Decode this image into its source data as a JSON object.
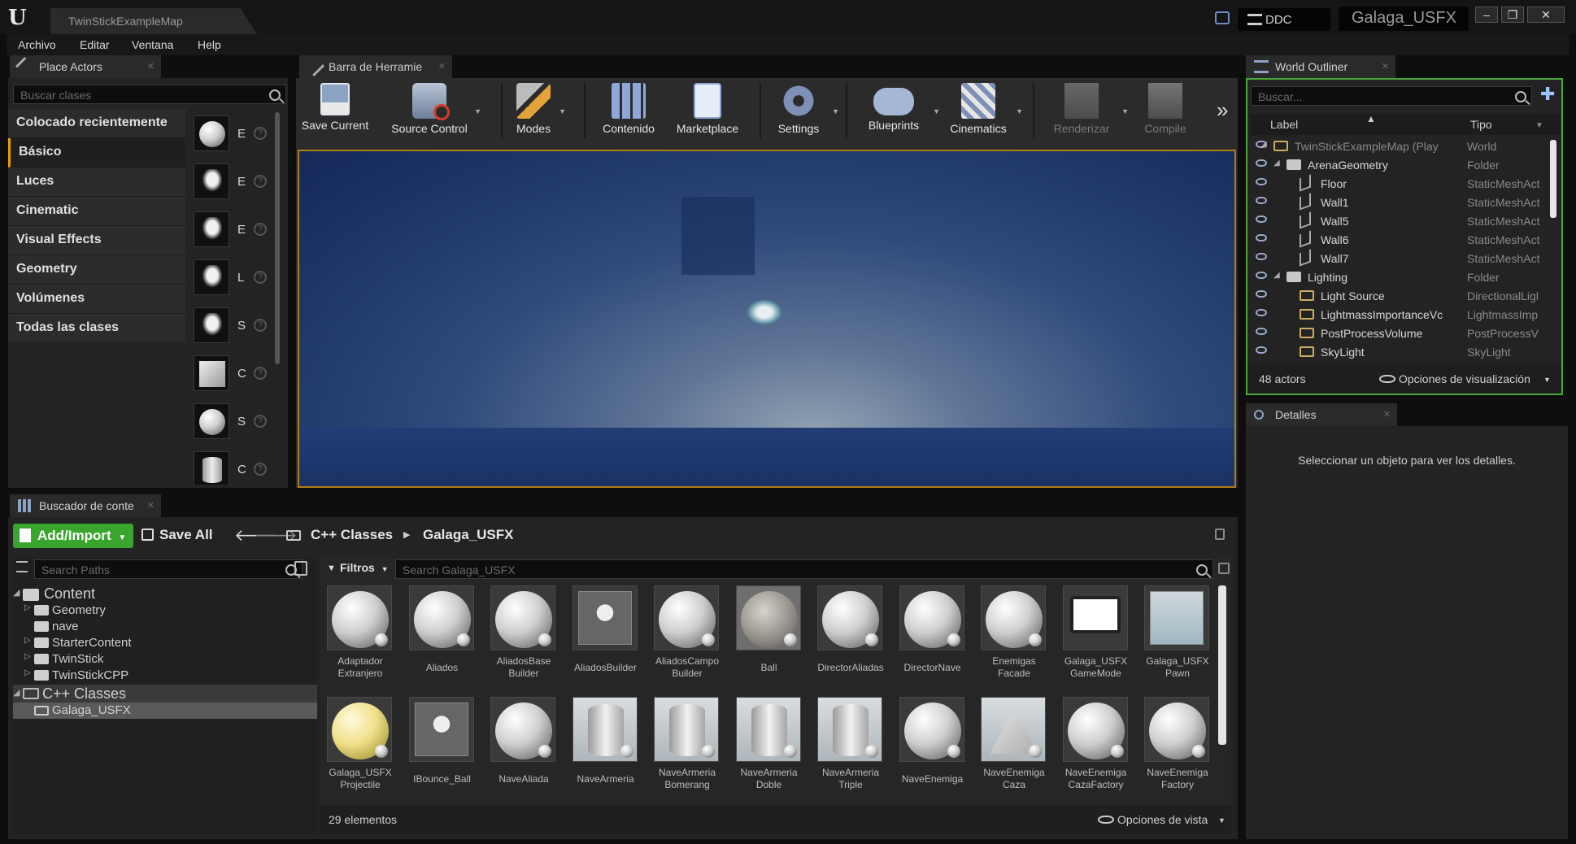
{
  "window": {
    "map_tab": "TwinStickExampleMap",
    "ddc_label": "DDC",
    "project_name": "Galaga_USFX",
    "controls": [
      "‒",
      "❐",
      "✕"
    ]
  },
  "menu": [
    "Archivo",
    "Editar",
    "Ventana",
    "Help"
  ],
  "place_actors": {
    "tab": "Place Actors",
    "search_placeholder": "Buscar clases",
    "categories": [
      "Colocado recientemente",
      "Básico",
      "Luces",
      "Cinematic",
      "Visual Effects",
      "Geometry",
      "Volúmenes",
      "Todas las clases"
    ],
    "items": [
      "E",
      "E",
      "E",
      "L",
      "S",
      "C",
      "S",
      "C"
    ]
  },
  "toolbar": {
    "tab": "Barra de Herramie",
    "buttons": [
      "Save Current",
      "Source Control",
      "Modes",
      "Contenido",
      "Marketplace",
      "Settings",
      "Blueprints",
      "Cinematics",
      "Renderizar",
      "Compile"
    ],
    "more": "»"
  },
  "outliner": {
    "tab": "World Outliner",
    "search_placeholder": "Buscar...",
    "col_label": "Label",
    "col_type": "Tipo",
    "rows": [
      {
        "label": "TwinStickExampleMap (Play",
        "type": "World"
      },
      {
        "label": "ArenaGeometry",
        "type": "Folder"
      },
      {
        "label": "Floor",
        "type": "StaticMeshAct"
      },
      {
        "label": "Wall1",
        "type": "StaticMeshAct"
      },
      {
        "label": "Wall5",
        "type": "StaticMeshAct"
      },
      {
        "label": "Wall6",
        "type": "StaticMeshAct"
      },
      {
        "label": "Wall7",
        "type": "StaticMeshAct"
      },
      {
        "label": "Lighting",
        "type": "Folder"
      },
      {
        "label": "Light Source",
        "type": "DirectionalLigl"
      },
      {
        "label": "LightmassImportanceVc",
        "type": "LightmassImp"
      },
      {
        "label": "PostProcessVolume",
        "type": "PostProcessV"
      },
      {
        "label": "SkyLight",
        "type": "SkyLight"
      }
    ],
    "count": "48 actors",
    "view_options": "Opciones de visualización"
  },
  "details": {
    "tab": "Detalles",
    "empty_message": "Seleccionar un objeto para ver los detalles."
  },
  "content_browser": {
    "tab": "Buscador de conte",
    "add_import": "Add/Import",
    "save_all": "Save All",
    "breadcrumb": [
      "C++ Classes",
      "Galaga_USFX"
    ],
    "search_paths_placeholder": "Search Paths",
    "filters": "Filtros",
    "search_placeholder": "Search Galaga_USFX",
    "tree": {
      "content": "Content",
      "folders": [
        "Geometry",
        "nave",
        "StarterContent",
        "TwinStick",
        "TwinStickCPP"
      ],
      "cpp": "C++ Classes",
      "cpp_child": "Galaga_USFX"
    },
    "assets": [
      {
        "line1": "Adaptador",
        "line2": "Extranjero",
        "kind": "sphere"
      },
      {
        "line1": "Aliados",
        "line2": "",
        "kind": "sphere"
      },
      {
        "line1": "AliadosBase",
        "line2": "Builder",
        "kind": "sphere"
      },
      {
        "line1": "AliadosBuilder",
        "line2": "",
        "kind": "interface"
      },
      {
        "line1": "AliadosCampo",
        "line2": "Builder",
        "kind": "sphere"
      },
      {
        "line1": "Ball",
        "line2": "",
        "kind": "ball"
      },
      {
        "line1": "DirectorAliadas",
        "line2": "",
        "kind": "sphere"
      },
      {
        "line1": "DirectorNave",
        "line2": "",
        "kind": "sphere"
      },
      {
        "line1": "Enemigas",
        "line2": "Facade",
        "kind": "sphere"
      },
      {
        "line1": "Galaga_USFX",
        "line2": "GameMode",
        "kind": "gamemode"
      },
      {
        "line1": "Galaga_USFX",
        "line2": "Pawn",
        "kind": "pawn"
      },
      {
        "line1": "Galaga_USFX",
        "line2": "Projectile",
        "kind": "yellow"
      },
      {
        "line1": "IBounce_Ball",
        "line2": "",
        "kind": "interface"
      },
      {
        "line1": "NaveAliada",
        "line2": "",
        "kind": "sphere"
      },
      {
        "line1": "NaveArmeria",
        "line2": "",
        "kind": "cylinder"
      },
      {
        "line1": "NaveArmeria",
        "line2": "Bomerang",
        "kind": "cylinder"
      },
      {
        "line1": "NaveArmeria",
        "line2": "Doble",
        "kind": "cylinder"
      },
      {
        "line1": "NaveArmeria",
        "line2": "Triple",
        "kind": "cylinder"
      },
      {
        "line1": "NaveEnemiga",
        "line2": "",
        "kind": "sphere"
      },
      {
        "line1": "NaveEnemiga",
        "line2": "Caza",
        "kind": "cone"
      },
      {
        "line1": "NaveEnemiga",
        "line2": "CazaFactory",
        "kind": "sphere"
      },
      {
        "line1": "NaveEnemiga",
        "line2": "Factory",
        "kind": "sphere"
      }
    ],
    "item_count": "29 elementos",
    "view_options": "Opciones de vista"
  }
}
